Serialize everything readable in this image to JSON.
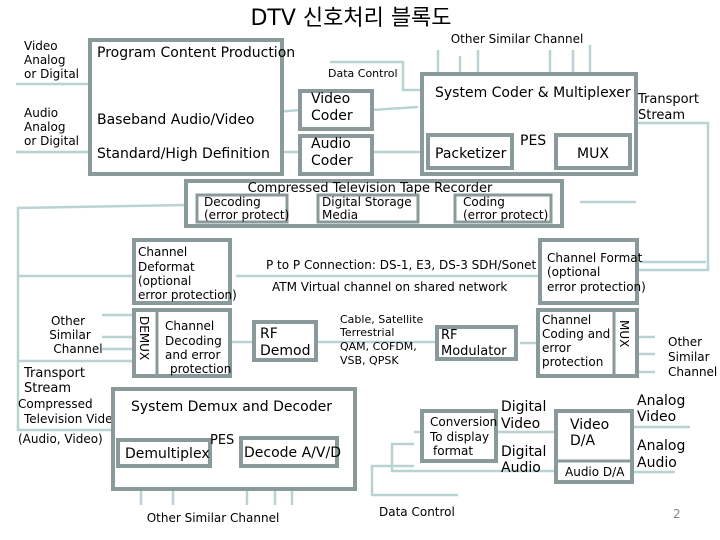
{
  "title": "DTV 신호처리 블록도",
  "page_number": "2",
  "colors": {
    "box_border": "#8a9a9a",
    "connector": "#b9d3d3",
    "text": "#000000",
    "background": "#ffffff"
  },
  "inputs": {
    "video": [
      "Video",
      "Analog",
      "or Digital"
    ],
    "audio": [
      "Audio",
      "Analog",
      "or Digital"
    ]
  },
  "program_production": {
    "title": "Program Content Production",
    "line1": "Baseband Audio/Video",
    "line2": "Standard/High Definition"
  },
  "data_control_top": "Data Control",
  "video_coder": [
    "Video",
    "Coder"
  ],
  "audio_coder": [
    "Audio",
    "Coder"
  ],
  "other_similar_channel_top": "Other Similar Channel",
  "system_coder": {
    "title": "System  Coder & Multiplexer",
    "packetizer": "Packetizer",
    "pes": "PES",
    "mux": "MUX"
  },
  "transport_stream_out": [
    "Transport",
    "Stream"
  ],
  "tape_recorder": {
    "title": "Compressed Television Tape Recorder",
    "decoding": [
      "Decoding",
      "(error protect)"
    ],
    "storage": [
      "Digital Storage",
      "Media"
    ],
    "coding": [
      "Coding",
      "(error protect)"
    ]
  },
  "channel_deformat": [
    "Channel",
    "Deformat",
    "(optional",
    "error protection)"
  ],
  "network": {
    "line1": "P to P Connection: DS-1, E3, DS-3 SDH/Sonet",
    "line2": "ATM Virtual channel on shared network"
  },
  "channel_format": [
    "Channel Format",
    "(optional",
    "error protection)"
  ],
  "demux_label": "DEMUX",
  "channel_decoding": [
    "Channel",
    "Decoding",
    "and  error",
    "protection"
  ],
  "other_similar_channel_left": [
    "Other",
    "Similar",
    "Channel"
  ],
  "rf_demod": [
    "RF",
    "Demod"
  ],
  "transmission_media": [
    "Cable, Satellite",
    "Terrestrial",
    "QAM, COFDM,",
    "VSB, QPSK"
  ],
  "rf_modulator": [
    "RF",
    "Modulator"
  ],
  "channel_coding": [
    "Channel",
    "Coding  and",
    "error",
    "protection"
  ],
  "mux_right_label": "MUX",
  "other_similar_channel_right": [
    "Other",
    "Similar",
    "Channel"
  ],
  "transport_stream_left": [
    "Transport",
    "Stream"
  ],
  "compressed_tv_video": [
    "Compressed",
    "Television Video",
    "(Audio, Video)"
  ],
  "system_demux": {
    "title": "System Demux and Decoder",
    "demultiplex": "Demultiplex",
    "pes": "PES",
    "decode": "Decode A/V/D"
  },
  "other_similar_channel_bottom": "Other Similar Channel",
  "conversion": [
    "Conversion",
    "To display",
    "format"
  ],
  "digital_video": [
    "Digital",
    "Video"
  ],
  "digital_audio": [
    "Digital",
    "Audio"
  ],
  "video_da": [
    "Video",
    "D/A"
  ],
  "audio_da": "Audio D/A",
  "analog_video": [
    "Analog",
    "Video"
  ],
  "analog_audio": [
    "Analog",
    "Audio"
  ],
  "data_control_bottom": "Data Control"
}
